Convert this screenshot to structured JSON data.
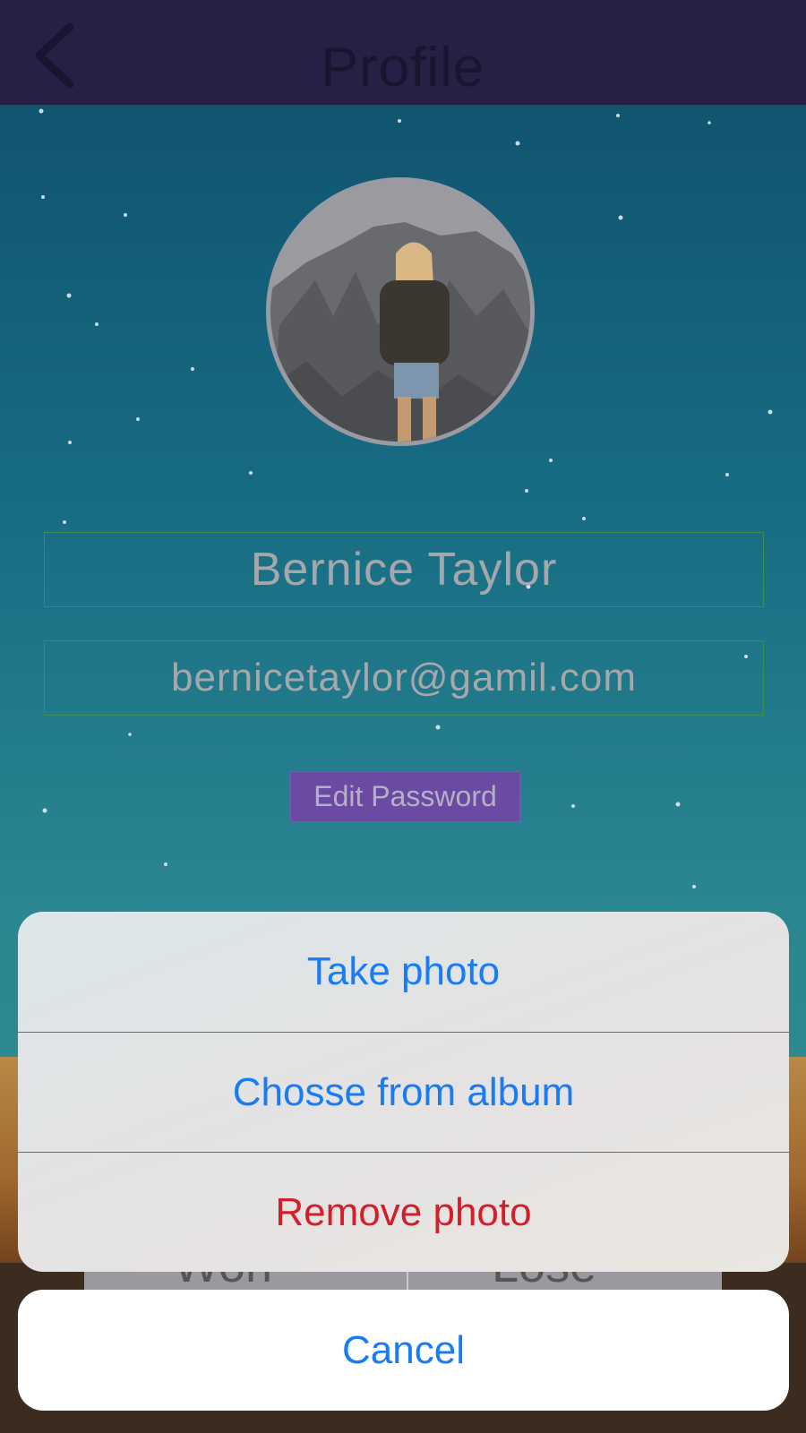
{
  "navbar": {
    "title": "Profile",
    "back_icon": "chevron-left-icon"
  },
  "profile": {
    "avatar_icon": "profile-photo",
    "name": "Bernice Taylor",
    "email": "bernicetaylor@gamil.com",
    "edit_password_label": "Edit Password"
  },
  "background_tabs": {
    "won": "Won",
    "lose": "Lose"
  },
  "action_sheet": {
    "items": [
      {
        "label": "Take photo"
      },
      {
        "label": "Chosse from album"
      },
      {
        "label": "Remove photo"
      }
    ],
    "cancel_label": "Cancel"
  },
  "colors": {
    "navbar": "#281f45",
    "action_blue": "#1a7cf3",
    "destructive_red": "#d21f2a",
    "edit_password_bg": "#6a4aa2"
  }
}
